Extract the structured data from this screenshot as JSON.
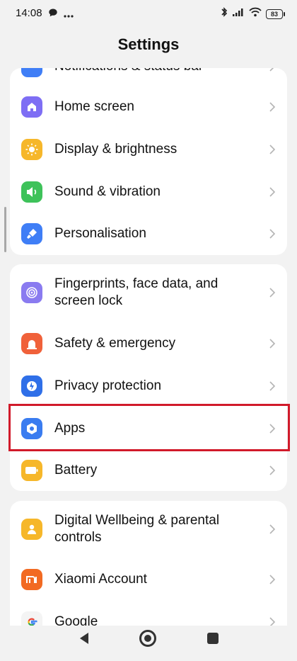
{
  "status": {
    "time": "14:08",
    "battery": "83"
  },
  "header": {
    "title": "Settings"
  },
  "groups": [
    {
      "items": [
        {
          "label": "Notifications & status bar",
          "icon": "notifications-icon"
        },
        {
          "label": "Home screen",
          "icon": "home-icon"
        },
        {
          "label": "Display & brightness",
          "icon": "sun-icon"
        },
        {
          "label": "Sound & vibration",
          "icon": "speaker-icon"
        },
        {
          "label": "Personalisation",
          "icon": "brush-icon"
        }
      ]
    },
    {
      "items": [
        {
          "label": "Fingerprints, face data, and screen lock",
          "icon": "fingerprint-icon"
        },
        {
          "label": "Safety & emergency",
          "icon": "emergency-icon"
        },
        {
          "label": "Privacy protection",
          "icon": "privacy-icon"
        },
        {
          "label": "Apps",
          "icon": "apps-icon"
        },
        {
          "label": "Battery",
          "icon": "battery-icon"
        }
      ]
    },
    {
      "items": [
        {
          "label": "Digital Wellbeing & parental controls",
          "icon": "wellbeing-icon"
        },
        {
          "label": "Xiaomi Account",
          "icon": "mi-icon"
        },
        {
          "label": "Google",
          "icon": "google-icon"
        }
      ]
    }
  ],
  "colors": {
    "background": "#f2f2f2",
    "card": "#ffffff",
    "highlight": "#d11a2a"
  }
}
